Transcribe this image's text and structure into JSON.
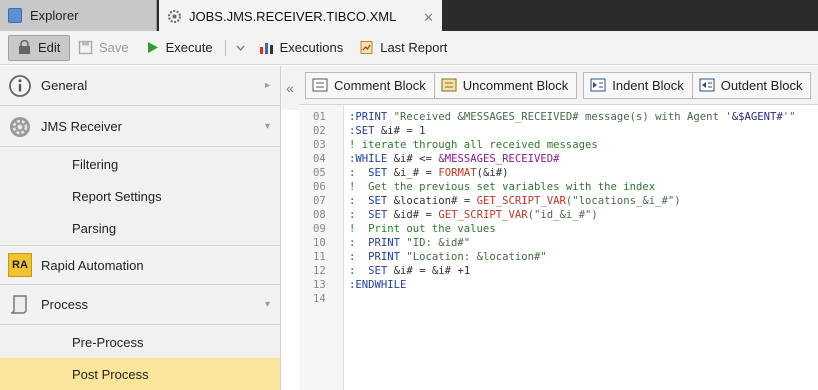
{
  "tabs": {
    "explorer": "Explorer",
    "job": "JOBS.JMS.RECEIVER.TIBCO.XML",
    "close": "✕"
  },
  "toolbar": {
    "edit": "Edit",
    "save": "Save",
    "execute": "Execute",
    "executions": "Executions",
    "last_report": "Last Report"
  },
  "nav": {
    "collapse": "«",
    "sections": [
      {
        "label": "General",
        "icon": "info-icon",
        "arrow": "▸"
      },
      {
        "label": "JMS Receiver",
        "icon": "jms-icon",
        "arrow": "▾"
      },
      {
        "label": "Rapid Automation",
        "icon": "ra-icon",
        "icon_text": "RA"
      },
      {
        "label": "Process",
        "icon": "process-icon",
        "arrow": "▾"
      }
    ],
    "jms_items": [
      "Filtering",
      "Report Settings",
      "Parsing"
    ],
    "process_items": [
      "Pre-Process",
      "Post Process"
    ]
  },
  "editor_toolbar": {
    "comment": "Comment Block",
    "uncomment": "Uncomment Block",
    "indent": "Indent Block",
    "outdent": "Outdent Block"
  },
  "code": {
    "line_numbers": [
      "01",
      "02",
      "03",
      "04",
      "05",
      "06",
      "07",
      "08",
      "09",
      "10",
      "11",
      "12",
      "13",
      "14"
    ],
    "lines": [
      [
        [
          ":PRINT",
          "kw"
        ],
        [
          " \"Received &MESSAGES_RECEIVED# message(s) with Agent '",
          "str"
        ],
        [
          "&$AGENT#",
          "var"
        ],
        [
          "'\"",
          "str"
        ]
      ],
      [
        [
          ":SET",
          "kw"
        ],
        [
          " &i# = 1",
          "pl"
        ]
      ],
      [
        [
          "! iterate through all received messages",
          "cmt"
        ]
      ],
      [
        [
          ":WHILE",
          "kw"
        ],
        [
          " &i# <= ",
          "pl"
        ],
        [
          "&MESSAGES_RECEIVED#",
          "sym"
        ]
      ],
      [
        [
          ":  SET",
          "kw"
        ],
        [
          " &i_# = ",
          "pl"
        ],
        [
          "FORMAT",
          "fn"
        ],
        [
          "(&i#)",
          "pl"
        ]
      ],
      [
        [
          "!  Get the previous set variables with the index",
          "cmt"
        ]
      ],
      [
        [
          ":  SET",
          "kw"
        ],
        [
          " &location# = ",
          "pl"
        ],
        [
          "GET_SCRIPT_VAR",
          "fn"
        ],
        [
          "(\"locations_&i_#\")",
          "str"
        ]
      ],
      [
        [
          ":  SET",
          "kw"
        ],
        [
          " &id# = ",
          "pl"
        ],
        [
          "GET_SCRIPT_VAR",
          "fn"
        ],
        [
          "(\"id_&i_#\")",
          "str"
        ]
      ],
      [
        [
          "!  Print out the values",
          "cmt"
        ]
      ],
      [
        [
          ":  PRINT",
          "kw"
        ],
        [
          " \"ID: &id#\"",
          "str"
        ]
      ],
      [
        [
          ":  PRINT",
          "kw"
        ],
        [
          " \"Location: &location#\"",
          "str"
        ]
      ],
      [
        [
          ":  SET",
          "kw"
        ],
        [
          " &i# = &i# +1",
          "pl"
        ]
      ],
      [
        [
          ":ENDWHILE",
          "kw"
        ]
      ],
      [
        [
          "",
          "pl"
        ]
      ]
    ]
  }
}
